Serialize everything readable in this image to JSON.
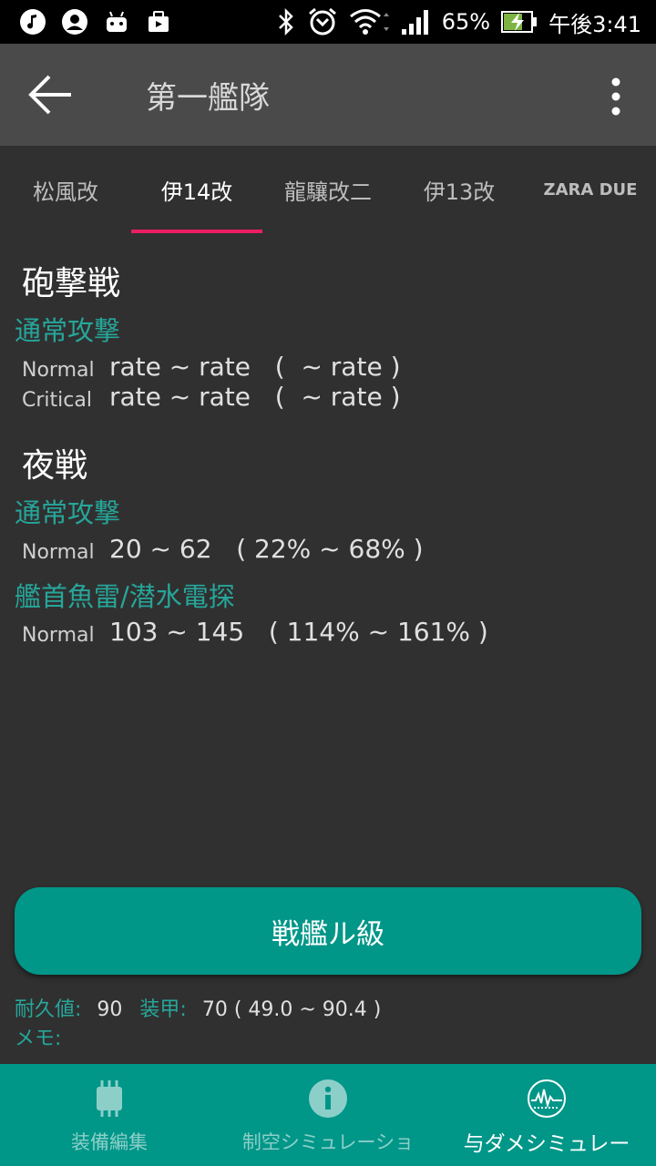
{
  "status_bar": {
    "battery": "65%",
    "time": "午後3:41"
  },
  "app_bar": {
    "title": "第一艦隊"
  },
  "tabs": [
    {
      "label": "松風改"
    },
    {
      "label": "伊14改"
    },
    {
      "label": "龍驤改二"
    },
    {
      "label": "伊13改"
    },
    {
      "label": "ZARA DUE"
    }
  ],
  "day_battle": {
    "title": "砲撃戦",
    "attack_name": "通常攻撃",
    "normal_label": "Normal",
    "normal_value": "rate ~ rate   (  ~ rate )",
    "critical_label": "Critical",
    "critical_value": "rate ~ rate   (  ~ rate )"
  },
  "night_battle": {
    "title": "夜戦",
    "attacks": [
      {
        "name": "通常攻撃",
        "label": "Normal",
        "value": "20 ~ 62   ( 22% ~ 68% )"
      },
      {
        "name": "艦首魚雷/潜水電探",
        "label": "Normal",
        "value": "103 ~ 145   ( 114% ~ 161% )"
      }
    ]
  },
  "enemy": {
    "button_label": "戦艦ル級",
    "hp_key": "耐久値:",
    "hp_value": "90",
    "armor_key": "装甲:",
    "armor_value": "70 ( 49.0 ~ 90.4 )",
    "memo_key": "メモ:"
  },
  "bottom_nav": [
    {
      "label": "装備編集",
      "icon": "chip-icon"
    },
    {
      "label": "制空シミュレーショ",
      "icon": "info-icon"
    },
    {
      "label": "与ダメシミュレー",
      "icon": "waveform-icon"
    }
  ],
  "colors": {
    "accent": "#26a69a",
    "primary": "#009688",
    "indicator": "#e91e63",
    "background": "#303030",
    "app_bar": "#4a4a4a"
  }
}
